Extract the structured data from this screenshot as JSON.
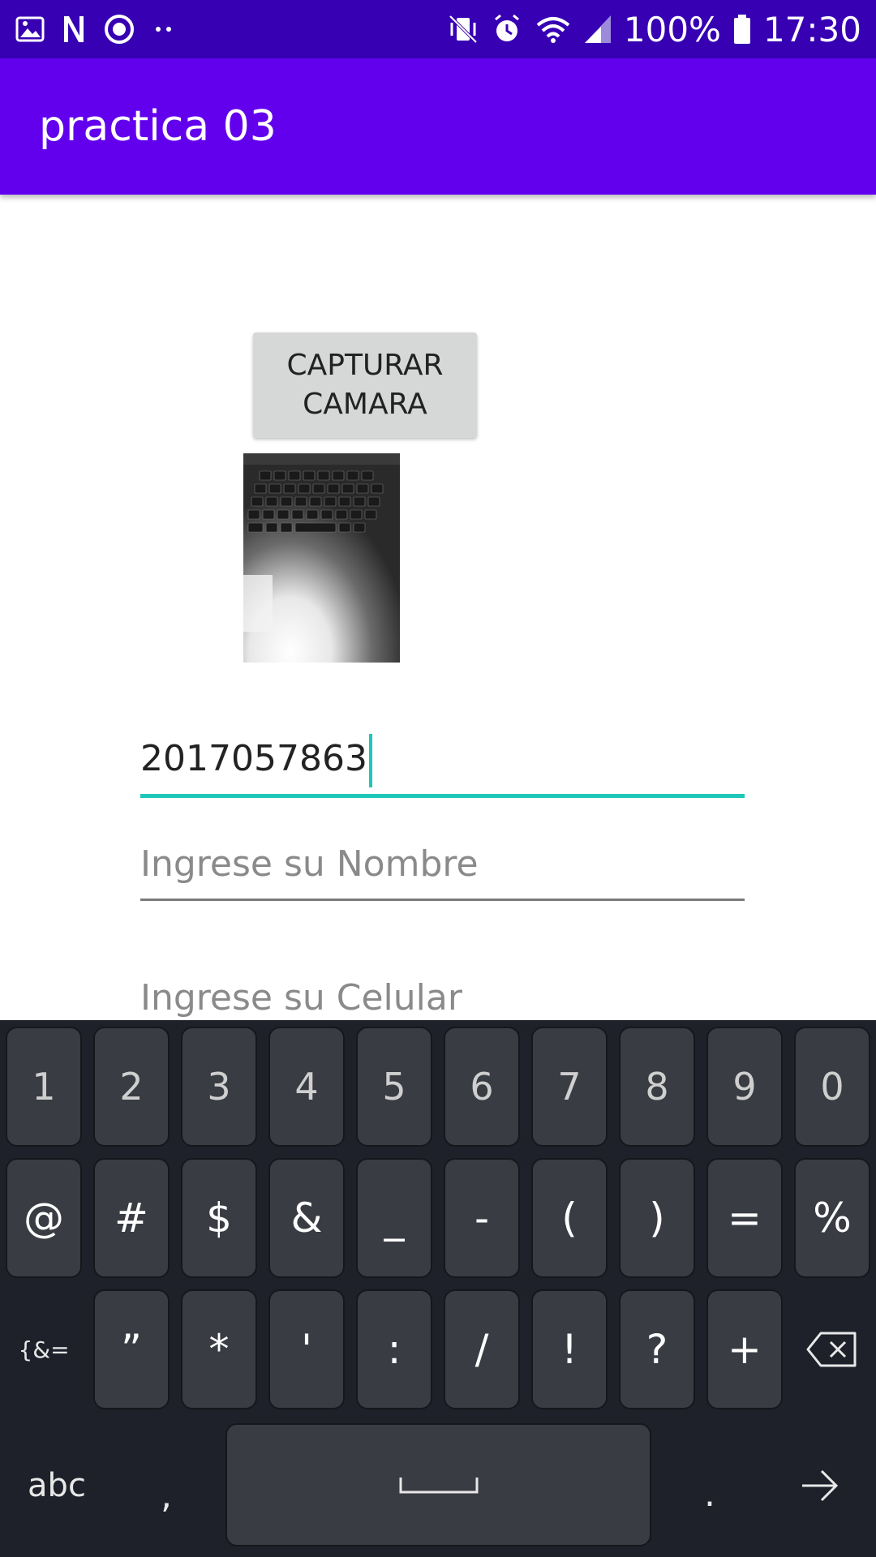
{
  "status_bar": {
    "battery": "100%",
    "time": "17:30",
    "left_icons": [
      "gallery-icon",
      "n-icon",
      "sync-icon",
      "more-dots-icon"
    ],
    "right_icons": [
      "vibrate-icon",
      "alarm-icon",
      "wifi-icon",
      "signal-icon",
      "battery-icon"
    ]
  },
  "app_bar": {
    "title": "practica 03"
  },
  "capture_button": {
    "label": "CAPTURAR\nCAMARA"
  },
  "photo": {
    "description_icon": "captured-photo"
  },
  "form": {
    "code_value": "2017057863",
    "name_placeholder": "Ingrese su Nombre",
    "cell_placeholder": "Ingrese su Celular"
  },
  "keyboard": {
    "row1": [
      "1",
      "2",
      "3",
      "4",
      "5",
      "6",
      "7",
      "8",
      "9",
      "0"
    ],
    "row2": [
      "@",
      "#",
      "$",
      "&",
      "_",
      "-",
      "(",
      ")",
      "=",
      "%"
    ],
    "row3_mode": "{&=",
    "row3": [
      "”",
      "*",
      "'",
      ":",
      "/",
      "!",
      "?",
      "+"
    ],
    "row4_abc": "abc",
    "row4_comma": ",",
    "row4_period": ".",
    "accent_color": "#1ec8b8"
  }
}
